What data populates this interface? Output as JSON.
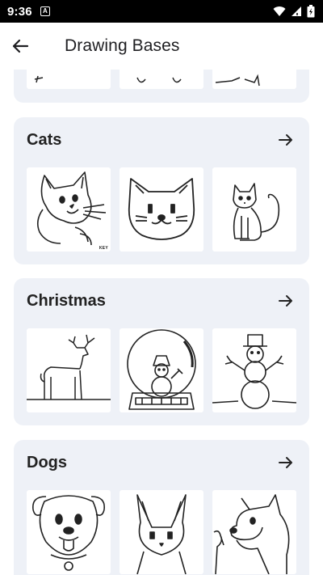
{
  "status_bar": {
    "time": "9:36",
    "app_icon_letter": "A",
    "icons": [
      "wifi-icon",
      "signal-icon",
      "battery-icon"
    ]
  },
  "app_bar": {
    "title": "Drawing Bases",
    "back_icon": "arrow-left-icon"
  },
  "categories": [
    {
      "name": "",
      "images": [
        "drawing-partial-1",
        "drawing-partial-2",
        "drawing-partial-3"
      ]
    },
    {
      "name": "Cats",
      "images": [
        "cat-drawing-1",
        "cat-face-drawing",
        "sitting-cat-drawing"
      ],
      "watermark": "KEY"
    },
    {
      "name": "Christmas",
      "images": [
        "reindeer-drawing",
        "snow-globe-drawing",
        "snowman-drawing"
      ]
    },
    {
      "name": "Dogs",
      "images": [
        "puppy-drawing",
        "fox-drawing",
        "doge-drawing"
      ]
    }
  ],
  "colors": {
    "card_bg": "#eef1f7",
    "status_bar_bg": "#000000",
    "text": "#1c1c1e"
  }
}
